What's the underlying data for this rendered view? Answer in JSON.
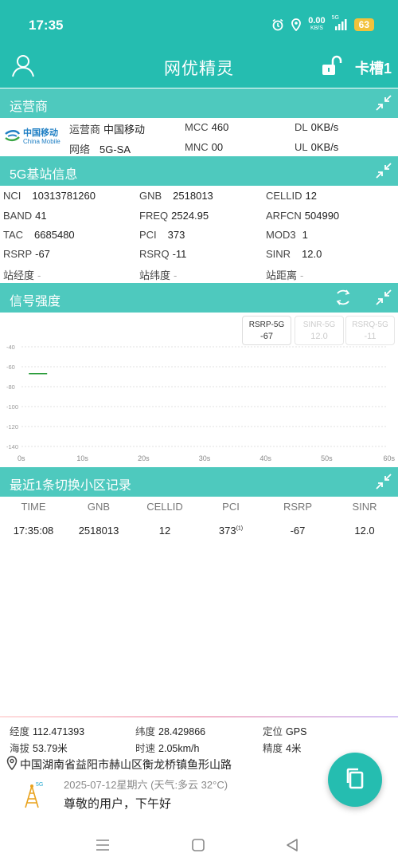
{
  "status_bar": {
    "time": "17:35",
    "net_speed_value": "0.00",
    "net_speed_unit": "KB/S",
    "network_type": "5G",
    "battery": "63"
  },
  "app_bar": {
    "title": "网优精灵",
    "sim_slot": "卡槽1"
  },
  "operator_section": {
    "title": "运营商",
    "logo_cn": "中国移动",
    "logo_en": "China Mobile",
    "fields": [
      {
        "key": "运营商",
        "value": "中国移动"
      },
      {
        "key": "网络",
        "value": "5G-SA"
      },
      {
        "key": "MCC",
        "value": "460"
      },
      {
        "key": "MNC",
        "value": "00"
      },
      {
        "key": "DL",
        "value": "0KB/s"
      },
      {
        "key": "UL",
        "value": "0KB/s"
      }
    ]
  },
  "cell_section": {
    "title": "5G基站信息",
    "fields": [
      {
        "key": "NCI",
        "value": "10313781260"
      },
      {
        "key": "GNB",
        "value": "2518013"
      },
      {
        "key": "CELLID",
        "value": "12"
      },
      {
        "key": "BAND",
        "value": "41"
      },
      {
        "key": "FREQ",
        "value": "2524.95"
      },
      {
        "key": "ARFCN",
        "value": "504990"
      },
      {
        "key": "TAC",
        "value": "6685480"
      },
      {
        "key": "PCI",
        "value": "373"
      },
      {
        "key": "MOD3",
        "value": "1"
      },
      {
        "key": "RSRP",
        "value": "-67"
      },
      {
        "key": "RSRQ",
        "value": "-11"
      },
      {
        "key": "SINR",
        "value": "12.0"
      },
      {
        "key": "站经度",
        "value": "-"
      },
      {
        "key": "站纬度",
        "value": "-"
      },
      {
        "key": "站距离",
        "value": "-"
      }
    ]
  },
  "signal_section": {
    "title": "信号强度",
    "legend": [
      {
        "name": "RSRP-5G",
        "value": "-67",
        "active": true
      },
      {
        "name": "SINR-5G",
        "value": "12.0",
        "active": false
      },
      {
        "name": "RSRQ-5G",
        "value": "-11",
        "active": false
      }
    ]
  },
  "chart_data": {
    "type": "line",
    "title": "",
    "xlabel": "",
    "ylabel": "",
    "x_ticks": [
      "0s",
      "10s",
      "20s",
      "30s",
      "40s",
      "50s",
      "60s"
    ],
    "y_ticks": [
      "-40",
      "-60",
      "-80",
      "-100",
      "-120",
      "-140"
    ],
    "xlim": [
      0,
      60
    ],
    "ylim": [
      -140,
      -40
    ],
    "grid": true,
    "series": [
      {
        "name": "RSRP-5G",
        "color": "#2e9e3e",
        "x": [
          1.2,
          4.2
        ],
        "y": [
          -67,
          -67
        ]
      }
    ]
  },
  "handover_section": {
    "title": "最近1条切换小区记录",
    "columns": [
      "TIME",
      "GNB",
      "CELLID",
      "PCI",
      "RSRP",
      "SINR"
    ],
    "rows": [
      {
        "time": "17:35:08",
        "gnb": "2518013",
        "cellid": "12",
        "pci": "373",
        "pci_sup": "(1)",
        "rsrp": "-67",
        "sinr": "12.0"
      }
    ]
  },
  "location": {
    "fields": [
      {
        "key": "经度",
        "value": "112.471393"
      },
      {
        "key": "纬度",
        "value": "28.429866"
      },
      {
        "key": "定位",
        "value": "GPS"
      },
      {
        "key": "海拔",
        "value": "53.79米"
      },
      {
        "key": "时速",
        "value": "2.05km/h"
      },
      {
        "key": "精度",
        "value": "4米"
      }
    ],
    "address": "中国湖南省益阳市赫山区衡龙桥镇鱼形山路"
  },
  "greeting": {
    "date_line": "2025-07-12星期六 (天气:多云  32°C)",
    "message": "尊敬的用户，下午好",
    "icon_badge": "5G"
  },
  "colors": {
    "primary": "#25bdb0",
    "section_header": "#4ec9be",
    "battery": "#f2c23b",
    "rsrp_line": "#2e9e3e",
    "china_mobile_blue": "#1f7fc4"
  }
}
